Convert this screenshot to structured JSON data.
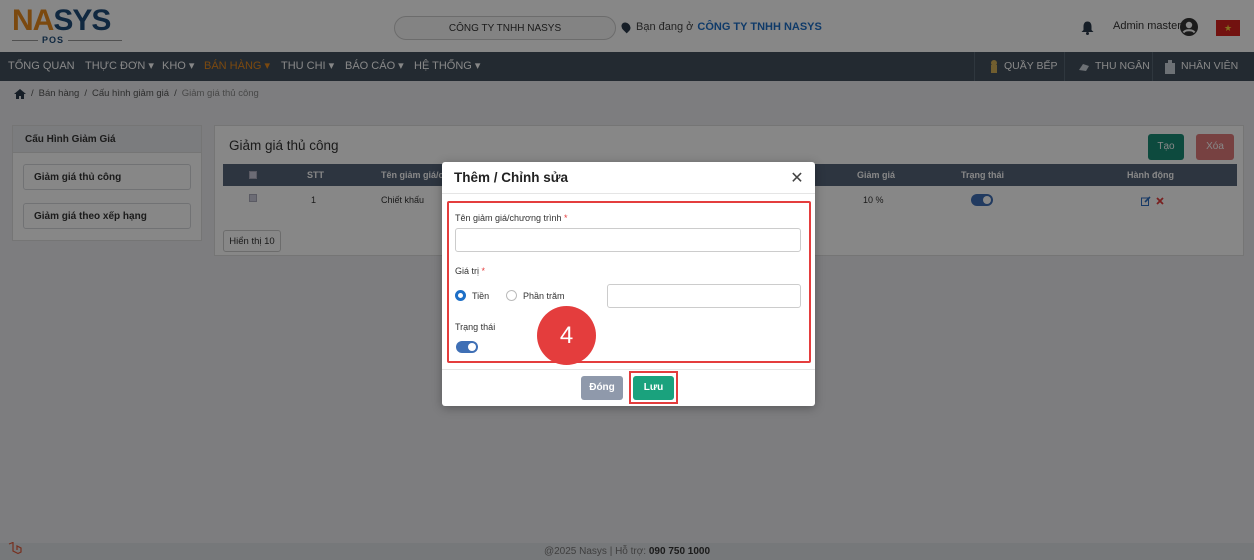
{
  "header": {
    "logo_na": "NA",
    "logo_sys": "SYS",
    "logo_pos": "POS",
    "company_pill": "CÔNG TY TNHH NASYS",
    "location_prefix": "Bạn đang ở",
    "location_company": "CÔNG TY TNHH NASYS",
    "admin_name": "Admin master",
    "flag_star": "★"
  },
  "nav": {
    "items": [
      "TỔNG QUAN",
      "THỰC ĐƠN ▾",
      "KHO ▾",
      "BÁN HÀNG ▾",
      "THU CHI ▾",
      "BÁO CÁO ▾",
      "HỆ THỐNG ▾"
    ],
    "right": [
      "QUẦY BẾP",
      "THU NGÂN",
      "NHÂN VIÊN"
    ]
  },
  "breadcrumb": {
    "sep": "/",
    "items": [
      "Bán hàng",
      "Cấu hình giảm giá",
      "Giảm giá thủ công"
    ]
  },
  "sidebar": {
    "title": "Cấu Hình Giảm Giá",
    "items": [
      "Giảm giá thủ công",
      "Giảm giá theo xếp hạng"
    ]
  },
  "main": {
    "title": "Giảm giá thủ công",
    "create_label": "Tạo",
    "delete_label": "Xóa",
    "columns": [
      "STT",
      "Tên giảm giá/c",
      "Giảm giá",
      "Trạng thái",
      "Hành động"
    ],
    "rows": [
      {
        "stt": "1",
        "name": "Chiết khấu",
        "discount": "10 %",
        "status_on": true
      }
    ],
    "show_label": "Hiển thị 10"
  },
  "modal": {
    "title": "Thêm / Chỉnh sửa",
    "close": "✕",
    "name_label": "Tên giảm giá/chương trình",
    "name_value": "",
    "value_label": "Giá trị",
    "required_mark": "*",
    "radio_money": "Tiền",
    "radio_percent": "Phần trăm",
    "selected_radio": "Tiền",
    "amount_value": "",
    "status_label": "Trạng thái",
    "status_on": true,
    "step_number": "4",
    "close_label": "Đóng",
    "save_label": "Lưu"
  },
  "footer": {
    "text": "@2025 Nasys | Hỗ trợ:",
    "phone": "090 750 1000"
  },
  "colors": {
    "accent_orange": "#e98a1d",
    "nav_bg": "#42505e",
    "highlight_red": "#e43d3d",
    "save_green": "#1aa27d"
  }
}
